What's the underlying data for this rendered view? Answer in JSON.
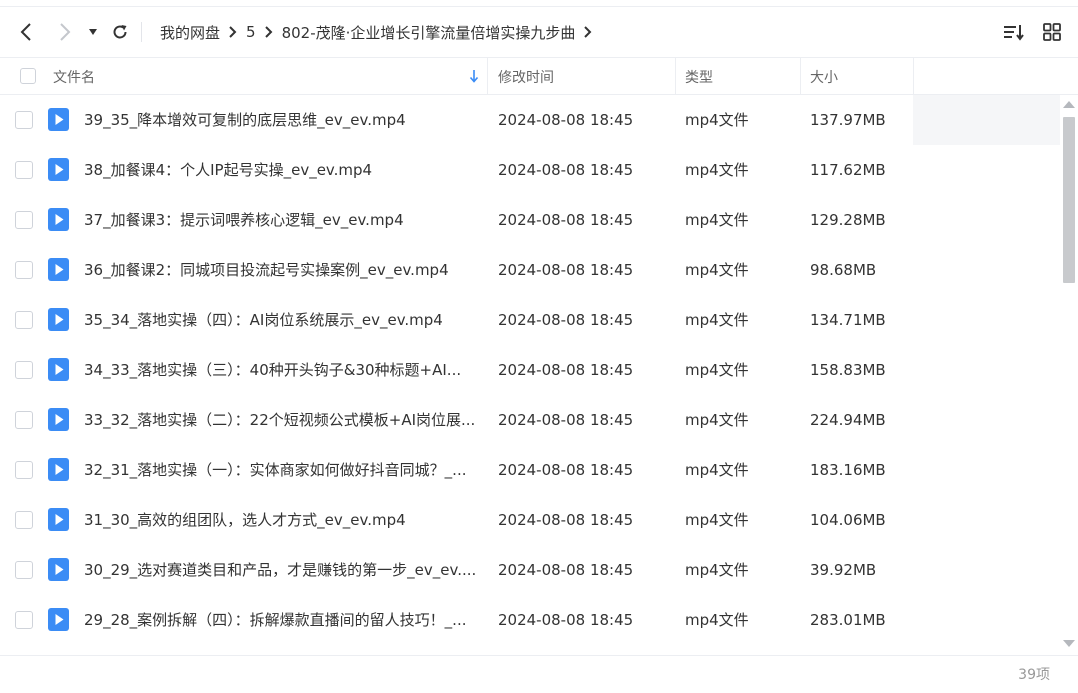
{
  "toolbar": {
    "back_icon": "chevron-left-icon",
    "forward_icon": "chevron-right-icon",
    "history_dropdown_icon": "caret-down-icon",
    "refresh_icon": "refresh-icon",
    "sort_icon": "sort-descending-icon",
    "grid_view_icon": "grid-view-icon"
  },
  "breadcrumb": [
    "我的网盘",
    "5",
    "802-茂隆·企业增长引擎流量倍增实操九步曲"
  ],
  "columns": {
    "name": "文件名",
    "modified": "修改时间",
    "type": "类型",
    "size": "大小"
  },
  "files": [
    {
      "name": "39_35_降本增效可复制的底层思维_ev_ev.mp4",
      "modified": "2024-08-08 18:45",
      "type": "mp4文件",
      "size": "137.97MB"
    },
    {
      "name": "38_加餐课4：个人IP起号实操_ev_ev.mp4",
      "modified": "2024-08-08 18:45",
      "type": "mp4文件",
      "size": "117.62MB"
    },
    {
      "name": "37_加餐课3：提示词喂养核心逻辑_ev_ev.mp4",
      "modified": "2024-08-08 18:45",
      "type": "mp4文件",
      "size": "129.28MB"
    },
    {
      "name": "36_加餐课2：同城项目投流起号实操案例_ev_ev.mp4",
      "modified": "2024-08-08 18:45",
      "type": "mp4文件",
      "size": "98.68MB"
    },
    {
      "name": "35_34_落地实操（四）：AI岗位系统展示_ev_ev.mp4",
      "modified": "2024-08-08 18:45",
      "type": "mp4文件",
      "size": "134.71MB"
    },
    {
      "name": "34_33_落地实操（三）：40种开头钩子&30种标题+AI...",
      "modified": "2024-08-08 18:45",
      "type": "mp4文件",
      "size": "158.83MB"
    },
    {
      "name": "33_32_落地实操（二）：22个短视频公式模板+AI岗位展...",
      "modified": "2024-08-08 18:45",
      "type": "mp4文件",
      "size": "224.94MB"
    },
    {
      "name": "32_31_落地实操（一）：实体商家如何做好抖音同城？_...",
      "modified": "2024-08-08 18:45",
      "type": "mp4文件",
      "size": "183.16MB"
    },
    {
      "name": "31_30_高效的组团队，选人才方式_ev_ev.mp4",
      "modified": "2024-08-08 18:45",
      "type": "mp4文件",
      "size": "104.06MB"
    },
    {
      "name": "30_29_选对赛道类目和产品，才是赚钱的第一步_ev_ev....",
      "modified": "2024-08-08 18:45",
      "type": "mp4文件",
      "size": "39.92MB"
    },
    {
      "name": "29_28_案例拆解（四）：拆解爆款直播间的留人技巧！_...",
      "modified": "2024-08-08 18:45",
      "type": "mp4文件",
      "size": "283.01MB"
    }
  ],
  "file_icon": "video-file-icon",
  "footer": {
    "count": "39项"
  },
  "colors": {
    "accent": "#3b8cf5",
    "text": "#333333",
    "muted": "#999999",
    "border": "#eceef2"
  }
}
